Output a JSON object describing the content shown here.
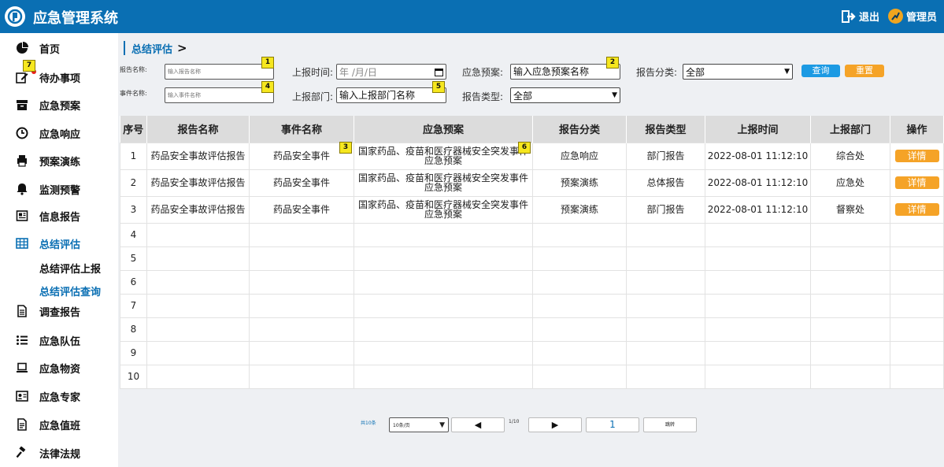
{
  "header": {
    "title": "应急管理系统",
    "logout": "退出",
    "user": "管理员"
  },
  "sidebar": {
    "items": [
      {
        "label": "首页",
        "icon": "pie-chart-icon"
      },
      {
        "label": "待办事项",
        "icon": "edit-icon"
      },
      {
        "label": "应急预案",
        "icon": "archive-box-icon"
      },
      {
        "label": "应急响应",
        "icon": "clock-icon"
      },
      {
        "label": "预案演练",
        "icon": "printer-icon"
      },
      {
        "label": "监测预警",
        "icon": "bell-icon"
      },
      {
        "label": "信息报告",
        "icon": "newspaper-icon"
      },
      {
        "label": "总结评估",
        "icon": "grid-table-icon"
      },
      {
        "label": "调查报告",
        "icon": "document-icon"
      },
      {
        "label": "应急队伍",
        "icon": "list-icon"
      },
      {
        "label": "应急物资",
        "icon": "laptop-icon"
      },
      {
        "label": "应急专家",
        "icon": "id-card-icon"
      },
      {
        "label": "应急值班",
        "icon": "file-text-icon"
      },
      {
        "label": "法律法规",
        "icon": "gavel-icon"
      }
    ],
    "sub_items": [
      "总结评估上报",
      "总结评估查询"
    ]
  },
  "breadcrumb": {
    "current": "总结评估",
    "separator": ">"
  },
  "filters": {
    "report_name_label": "报告名称:",
    "report_name_placeholder": "输入报告名称",
    "event_name_label": "事件名称:",
    "event_name_placeholder": "输入事件名称",
    "report_time_label": "上报时间:",
    "report_time_placeholder": "年 /月/日",
    "report_dept_label": "上报部门:",
    "report_dept_placeholder": "输入上报部门名称",
    "plan_label": "应急预案:",
    "plan_placeholder": "输入应急预案名称",
    "report_type_label": "报告类型:",
    "report_type_value": "全部",
    "category_label": "报告分类:",
    "category_value": "全部",
    "query_button": "查询",
    "reset_button": "重置"
  },
  "markers": [
    "1",
    "2",
    "3",
    "4",
    "5",
    "6",
    "7"
  ],
  "table": {
    "columns": [
      "序号",
      "报告名称",
      "事件名称",
      "应急预案",
      "报告分类",
      "报告类型",
      "上报时间",
      "上报部门",
      "操作"
    ],
    "rows": [
      {
        "no": "1",
        "name": "药品安全事故评估报告",
        "event": "药品安全事件",
        "plan": "国家药品、疫苗和医疗器械安全突发事件应急预案",
        "category": "应急响应",
        "type": "部门报告",
        "time": "2022-08-01 11:12:10",
        "dept": "综合处",
        "action": "详情"
      },
      {
        "no": "2",
        "name": "药品安全事故评估报告",
        "event": "药品安全事件",
        "plan": "国家药品、疫苗和医疗器械安全突发事件应急预案",
        "category": "预案演练",
        "type": "总体报告",
        "time": "2022-08-01 11:12:10",
        "dept": "应急处",
        "action": "详情"
      },
      {
        "no": "3",
        "name": "药品安全事故评估报告",
        "event": "药品安全事件",
        "plan": "国家药品、疫苗和医疗器械安全突发事件应急预案",
        "category": "预案演练",
        "type": "部门报告",
        "time": "2022-08-01 11:12:10",
        "dept": "督察处",
        "action": "详情"
      }
    ],
    "empty_rows": [
      "4",
      "5",
      "6",
      "7",
      "8",
      "9",
      "10"
    ]
  },
  "pager": {
    "total": "共10条",
    "page_size": "10条/页",
    "prev": "◀",
    "info": "1/10",
    "next": "▶",
    "page": "1",
    "jump": "跳转"
  },
  "colors": {
    "primary": "#0a6fb3",
    "accent_orange": "#f5a327",
    "query_blue": "#1c9ae3",
    "marker_yellow": "#f6e71f"
  }
}
